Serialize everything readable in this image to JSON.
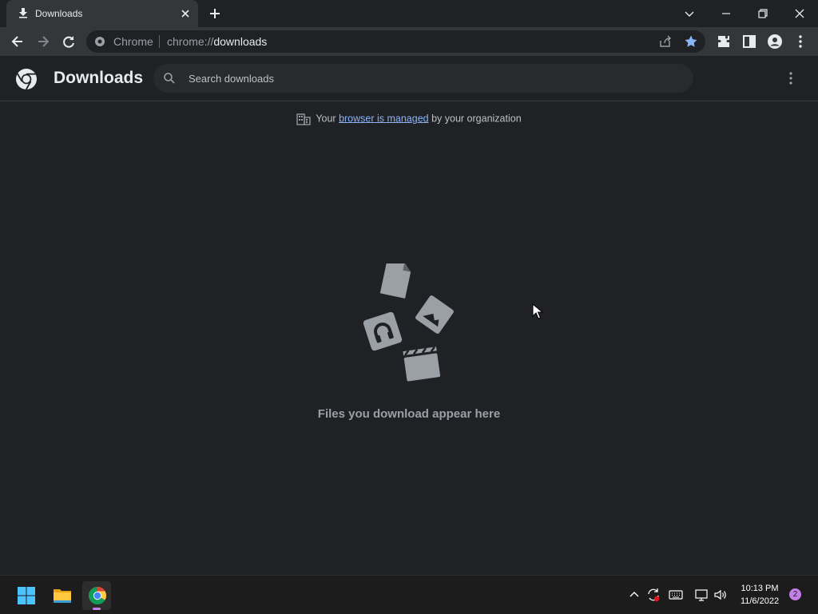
{
  "tab": {
    "title": "Downloads"
  },
  "omnibox": {
    "chip": "Chrome",
    "url_scheme": "chrome://",
    "url_host": "downloads"
  },
  "header": {
    "title": "Downloads"
  },
  "search": {
    "placeholder": "Search downloads"
  },
  "managed": {
    "prefix": "Your ",
    "link": "browser is managed",
    "suffix": " by your organization"
  },
  "empty": {
    "message": "Files you download appear here"
  },
  "taskbar": {
    "time": "10:13 PM",
    "date": "11/6/2022",
    "notifications": "2"
  },
  "colors": {
    "accent_blue": "#8ab4f8",
    "background": "#202124",
    "toolbar": "#35363a",
    "taskbar": "#1c1c1c",
    "notification_badge": "#c580e8"
  },
  "icons": [
    "download-icon",
    "close-icon",
    "new-tab-icon",
    "chevron-down-icon",
    "minimize-icon",
    "restore-icon",
    "back-icon",
    "forward-icon",
    "reload-icon",
    "chrome-site-icon",
    "share-icon",
    "bookmark-star-icon",
    "extensions-icon",
    "side-panel-icon",
    "profile-icon",
    "more-vert-icon",
    "chrome-logo-icon",
    "search-icon",
    "building-icon",
    "windows-start-icon",
    "file-explorer-icon",
    "chrome-taskbar-icon",
    "chevron-up-icon",
    "sync-icon",
    "keyboard-icon",
    "network-icon",
    "volume-icon"
  ]
}
